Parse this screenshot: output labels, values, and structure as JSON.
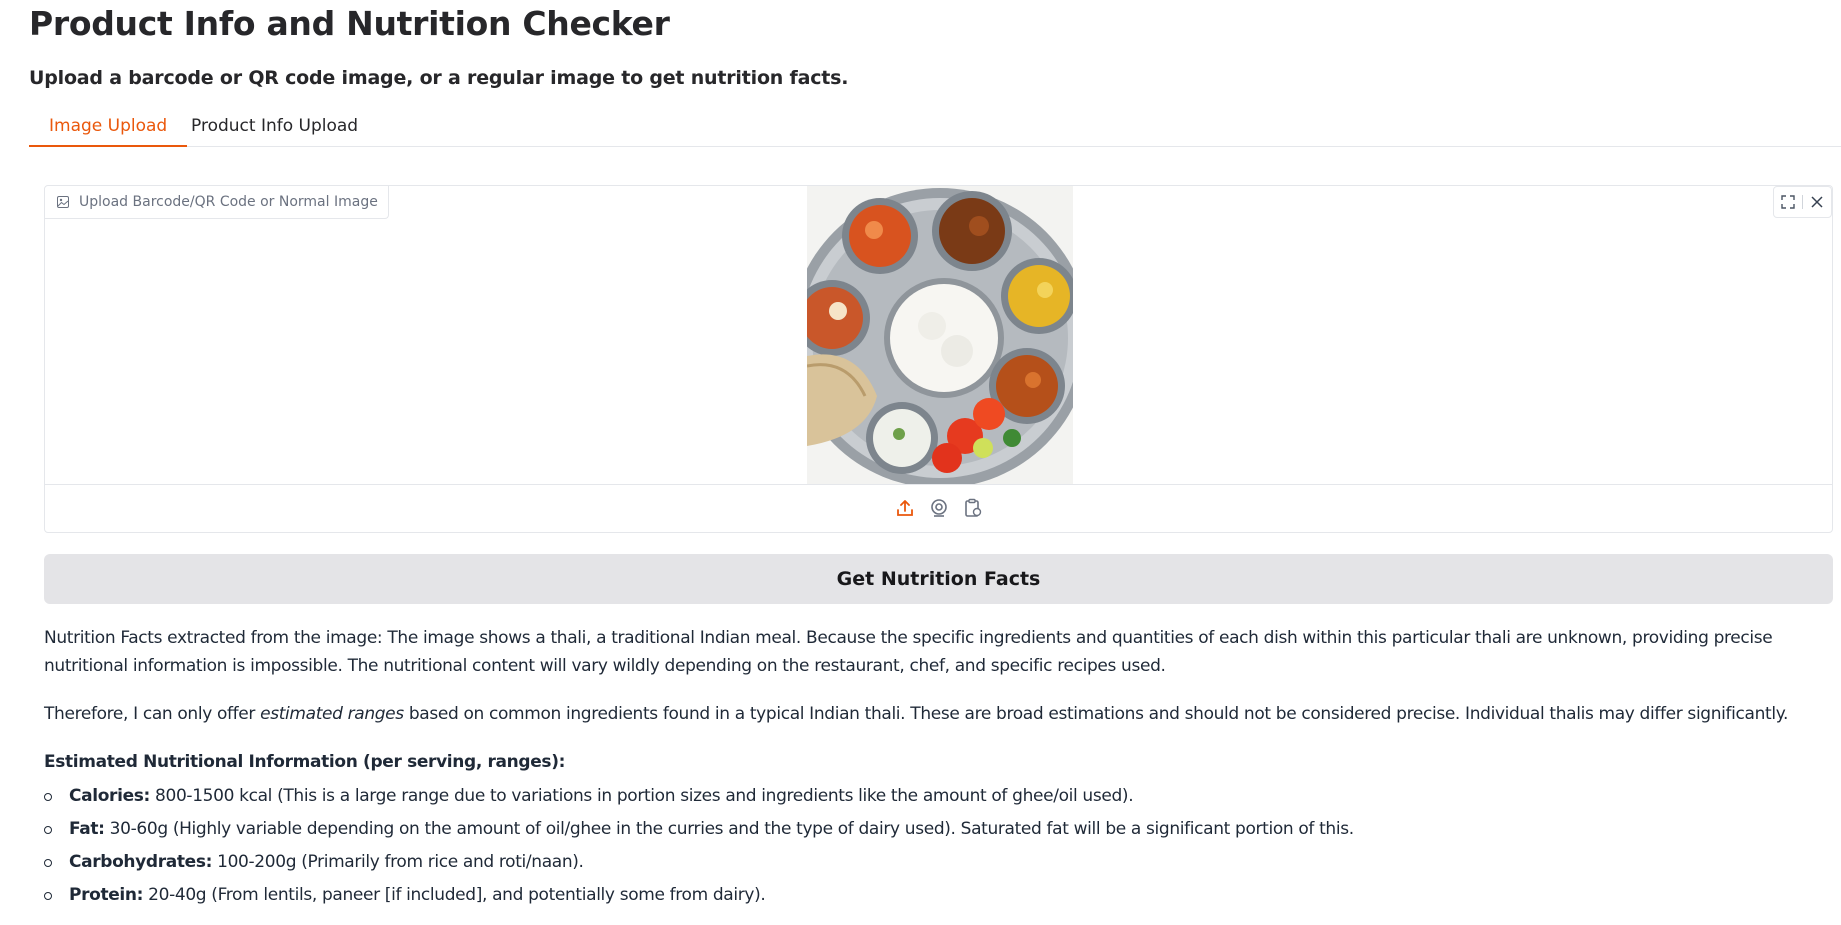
{
  "app": {
    "title": "Product Info and Nutrition Checker",
    "subtitle": "Upload a barcode or QR code image, or a regular image to get nutrition facts."
  },
  "tabs": [
    {
      "label": "Image Upload",
      "active": true
    },
    {
      "label": "Product Info Upload",
      "active": false
    }
  ],
  "image_upload": {
    "label": "Upload Barcode/QR Code or Normal Image",
    "label_icon": "image-icon",
    "toolbar_icons": [
      "fullscreen-icon",
      "close-icon"
    ],
    "source_icons": [
      "upload-icon",
      "webcam-icon",
      "clipboard-icon"
    ]
  },
  "action": {
    "button_label": "Get Nutrition Facts"
  },
  "output": {
    "para1": "Nutrition Facts extracted from the image: The image shows a thali, a traditional Indian meal. Because the specific ingredients and quantities of each dish within this particular thali are unknown, providing precise nutritional information is impossible. The nutritional content will vary wildly depending on the restaurant, chef, and specific recipes used.",
    "para2_before": "Therefore, I can only offer ",
    "para2_em": "estimated ranges",
    "para2_after": " based on common ingredients found in a typical Indian thali. These are broad estimations and should not be considered precise. Individual thalis may differ significantly.",
    "heading": "Estimated Nutritional Information (per serving, ranges):",
    "items": [
      {
        "label": "Calories:",
        "text": " 800-1500 kcal (This is a large range due to variations in portion sizes and ingredients like the amount of ghee/oil used)."
      },
      {
        "label": "Fat:",
        "text": " 30-60g (Highly variable depending on the amount of oil/ghee in the curries and the type of dairy used). Saturated fat will be a significant portion of this."
      },
      {
        "label": "Carbohydrates:",
        "text": " 100-200g (Primarily from rice and roti/naan)."
      },
      {
        "label": "Protein:",
        "text": " 20-40g (From lentils, paneer [if included], and potentially some from dairy)."
      }
    ]
  },
  "colors": {
    "accent": "#ea580c",
    "button_bg": "#e4e4e7"
  }
}
